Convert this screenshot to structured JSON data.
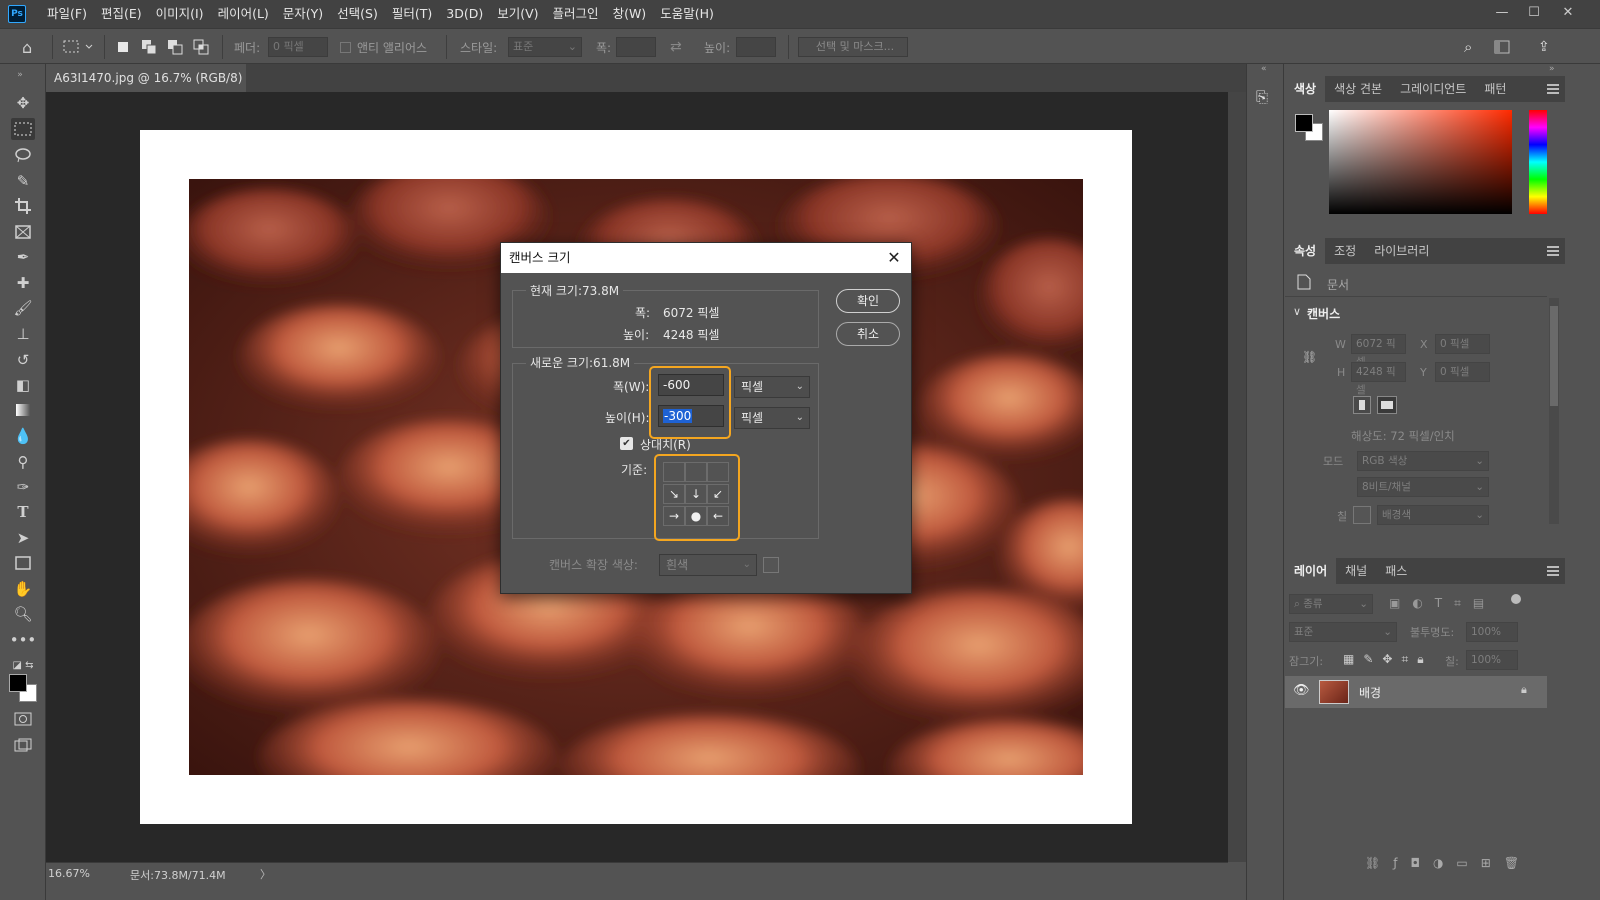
{
  "menubar": {
    "app_icon": "Ps",
    "items": [
      "파일(F)",
      "편집(E)",
      "이미지(I)",
      "레이어(L)",
      "문자(Y)",
      "선택(S)",
      "필터(T)",
      "3D(D)",
      "보기(V)",
      "플러그인",
      "창(W)",
      "도움말(H)"
    ]
  },
  "options_bar": {
    "feather_label": "페더:",
    "feather_value": "0 픽셀",
    "antialias_label": "앤티 앨리어스",
    "style_label": "스타일:",
    "style_value": "표준",
    "width_label": "폭:",
    "height_label": "높이:",
    "select_mask_button": "선택 및 마스크..."
  },
  "document": {
    "tab_title": "A63I1470.jpg @ 16.7% (RGB/8) *",
    "zoom": "16.67%",
    "doc_size": "문서:73.8M/71.4M"
  },
  "color_panel": {
    "tabs": [
      "색상",
      "색상 견본",
      "그레이디언트",
      "패턴"
    ],
    "active": "색상",
    "foreground": "#000000",
    "background": "#ffffff"
  },
  "properties_panel": {
    "tabs": [
      "속성",
      "조정",
      "라이브러리"
    ],
    "active": "속성",
    "doc_label": "문서",
    "section": "캔버스",
    "w_label": "W",
    "w_value": "6072 픽셀",
    "h_label": "H",
    "h_value": "4248 픽셀",
    "x_label": "X",
    "x_value": "0 픽셀",
    "y_label": "Y",
    "y_value": "0 픽셀",
    "resolution": "해상도: 72 픽셀/인치",
    "mode_label": "모드",
    "mode_value": "RGB 색상",
    "bit_value": "8비트/채널",
    "fill_label": "칠",
    "fill_value": "배경색"
  },
  "layers_panel": {
    "tabs": [
      "레이어",
      "채널",
      "패스"
    ],
    "active": "레이어",
    "filter_kind": "종류",
    "blend_mode": "표준",
    "opacity_label": "불투명도:",
    "opacity_value": "100%",
    "lock_label": "잠그기:",
    "fill_label": "칠:",
    "fill_value": "100%",
    "layers": [
      {
        "name": "배경",
        "visible": true,
        "locked": true
      }
    ]
  },
  "dialog": {
    "title": "캔버스 크기",
    "current_size_label": "현재 크기:73.8M",
    "current_width_label": "폭:",
    "current_width_value": "6072 픽셀",
    "current_height_label": "높이:",
    "current_height_value": "4248 픽셀",
    "new_size_label": "새로운 크기:61.8M",
    "width_label": "폭(W):",
    "width_value": "-600",
    "width_unit": "픽셀",
    "height_label": "높이(H):",
    "height_value": "-300",
    "height_unit": "픽셀",
    "relative_label": "상대치(R)",
    "relative_checked": true,
    "anchor_label": "기준:",
    "anchor_grid": [
      "",
      "",
      "",
      "↘",
      "↓",
      "↙",
      "→",
      "●",
      "←"
    ],
    "extension_color_label": "캔버스 확장 색상:",
    "extension_color_value": "흰색",
    "ok_button": "확인",
    "cancel_button": "취소",
    "highlight_color": "#f4a620"
  }
}
